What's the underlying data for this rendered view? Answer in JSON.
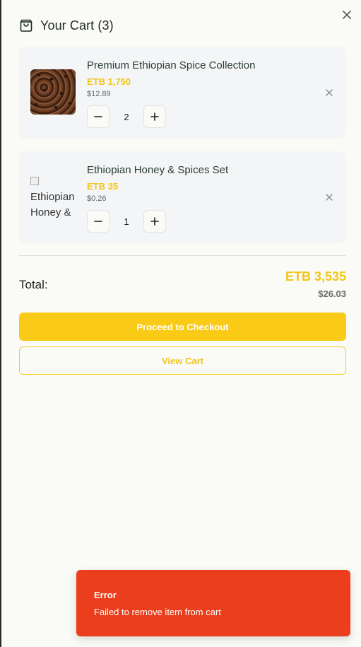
{
  "header": {
    "title": "Your Cart (3)",
    "icon": "shopping-bag-icon"
  },
  "items": [
    {
      "name": "Premium Ethiopian Spice Collection",
      "price_etb": "ETB 1,750",
      "price_usd": "$12.89",
      "quantity": "2",
      "image_alt": ""
    },
    {
      "name": "Ethiopian Honey & Spices Set",
      "price_etb": "ETB 35",
      "price_usd": "$0.26",
      "quantity": "1",
      "image_alt": "Ethiopian Honey & Spices Set"
    }
  ],
  "summary": {
    "total_label": "Total:",
    "total_etb": "ETB 3,535",
    "total_usd": "$26.03"
  },
  "actions": {
    "checkout_label": "Proceed to Checkout",
    "view_cart_label": "View Cart"
  },
  "toast": {
    "title": "Error",
    "message": "Failed to remove item from cart"
  },
  "colors": {
    "accent": "#f9cb17",
    "error": "#ea3e1c",
    "panel": "#fafaf6",
    "card": "#f3f5f7"
  }
}
